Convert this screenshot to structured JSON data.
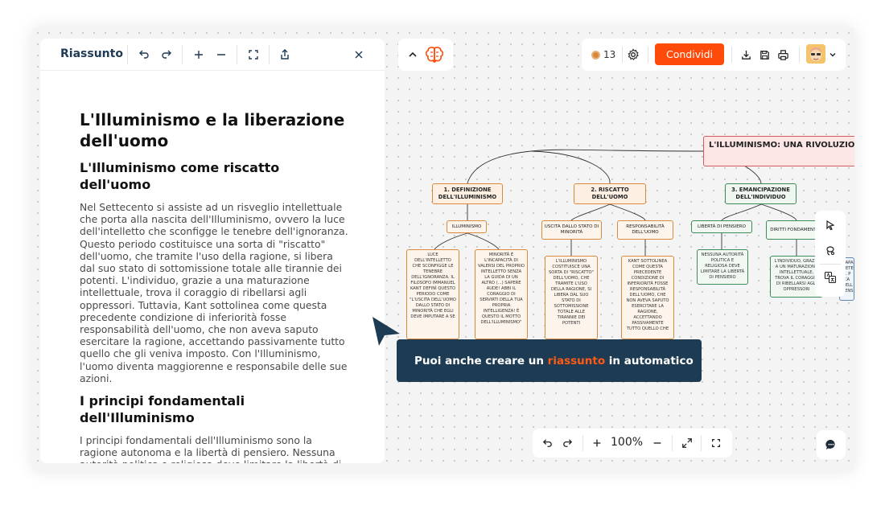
{
  "summary_panel": {
    "title": "Riassunto",
    "toolbar_icons": [
      "undo-icon",
      "redo-icon",
      "plus-icon",
      "minus-icon",
      "fullscreen-icon",
      "share-icon",
      "close-icon"
    ],
    "doc_title": "L'Illuminismo e la liberazione dell'uomo",
    "section1_title": "L'Illuminismo come riscatto dell'uomo",
    "section1_text": "Nel Settecento si assiste ad un risveglio intellettuale che porta alla nascita dell'Illuminismo, ovvero la luce dell'intelletto che sconfigge le tenebre dell'ignoranza. Questo periodo costituisce una sorta di \"riscatto\" dell'uomo, che tramite l'uso della ragione, si libera dal suo stato di sottomissione totale alle tirannie dei potenti. L'individuo, grazie a una maturazione intellettuale, trova il coraggio di ribellarsi agli oppressori. Tuttavia, Kant sottolinea come questa precedente condizione di inferiorità fosse responsabilità dell'uomo, che non aveva saputo esercitare la ragione, accettando passivamente tutto quello che gli veniva imposto. Con l'Illuminismo, l'uomo diventa maggiorenne e responsabile delle sue azioni.",
    "section2_title": "I principi fondamentali dell'Illuminismo",
    "section2_text": "I principi fondamentali dell'Illuminismo sono la ragione autonoma e la libertà di pensiero. Nessuna autorità politica o religiosa deve limitare la libertà di"
  },
  "topbar": {
    "credits": "13",
    "share_label": "Condividi",
    "icons": [
      "chevron-up-icon",
      "brain-icon",
      "settings-icon",
      "download-icon",
      "save-icon",
      "print-icon",
      "avatar",
      "chevron-down-icon"
    ]
  },
  "mindmap": {
    "root": "L'ILLUMINISMO: UNA RIVOLUZIONE INTELLETTUALE",
    "branch1": "1. DEFINIZIONE DELL'ILLUMINISMO",
    "branch2": "2. RISCATTO DELL'UOMO",
    "branch3": "3. EMANCIPAZIONE DELL'INDIVIDUO",
    "tag_illuminismo": "ILLUMINISMO",
    "tag_uscita": "USCITA DALLO STATO DI MINORITÀ",
    "tag_responsabilita": "RESPONSABILITÀ DELL'UOMO",
    "tag_liberta": "LIBERTÀ DI PENSIERO",
    "tag_diritti": "DIRITTI FONDAMENTALI",
    "leaf1": "LUCE DELL'INTELLETTO CHE SCONFIGGE LE TENEBRE DELL'IGNORANZA. IL FILOSOFO IMMANUEL KANT DEFINÌ QUESTO PERIODO COME \"L'USCITA DELL'UOMO DALLO STATO DI MINORITÀ CHE EGLI DEVE IMPUTARE A SE",
    "leaf2": "MINORITÀ È L'INCAPACITÀ DI VALERSI DEL PROPRIO INTELLETTO SENZA LA GUIDA DI UN ALTRO (...) SAPERE AUDE! ABBI IL CORAGGIO DI SERVIRTI DELLA TUA PROPRIA INTELLIGENZA! È QUESTO IL MOTTO DELL'ILLUMINISMO\"",
    "leaf3": "L'ILLUMINISMO COSTITUISCE UNA SORTA DI \"RISCATTO\" DELL'UOMO, CHE TRAMITE L'USO DELLA RAGIONE, SI LIBERA DAL SUO STATO DI SOTTOMISSIONE TOTALE ALLE TIRANNIE DEI POTENTI",
    "leaf4": "KANT SOTTOLINEA COME QUESTA PRECEDENTE CONDIZIONE DI INFERIORITÀ FOSSE RESPONSABILITÀ DELL'UOMO, CHE NON AVEVA SAPUTO ESERCITARE LA RAGIONE, ACCETTANDO PASSIVAMENTE TUTTO QUELLO CHE",
    "leaf5": "NESSUNA AUTORITÀ POLITICA E RELIGIOSA DEVE LIMITARE LA LIBERTÀ DI PENSIERO",
    "leaf6": "L'INDIVIDUO, GRAZIE A UN MATURAZIONE INTELLETTUALE, TROVA IL CORAGGIO DI RIBELLARSI AGLI OPPRESSORI",
    "leaf7": "CAPA DETE ... P CA NELL PENS"
  },
  "tooltip": {
    "before": "Puoi anche creare un ",
    "accent": "riassunto",
    "after": " in automatico"
  },
  "zoombar": {
    "zoom": "100%",
    "icons": [
      "undo-icon",
      "redo-icon",
      "plus-icon",
      "minus-icon",
      "expand-icon",
      "fullscreen-icon"
    ]
  },
  "side_tools": {
    "icons": [
      "select-cursor-icon",
      "lasso-icon",
      "translate-icon"
    ]
  },
  "colors": {
    "accent": "#ff4b0a",
    "tooltip_bg": "#1d3c54",
    "title_blue": "#1f3a56"
  }
}
